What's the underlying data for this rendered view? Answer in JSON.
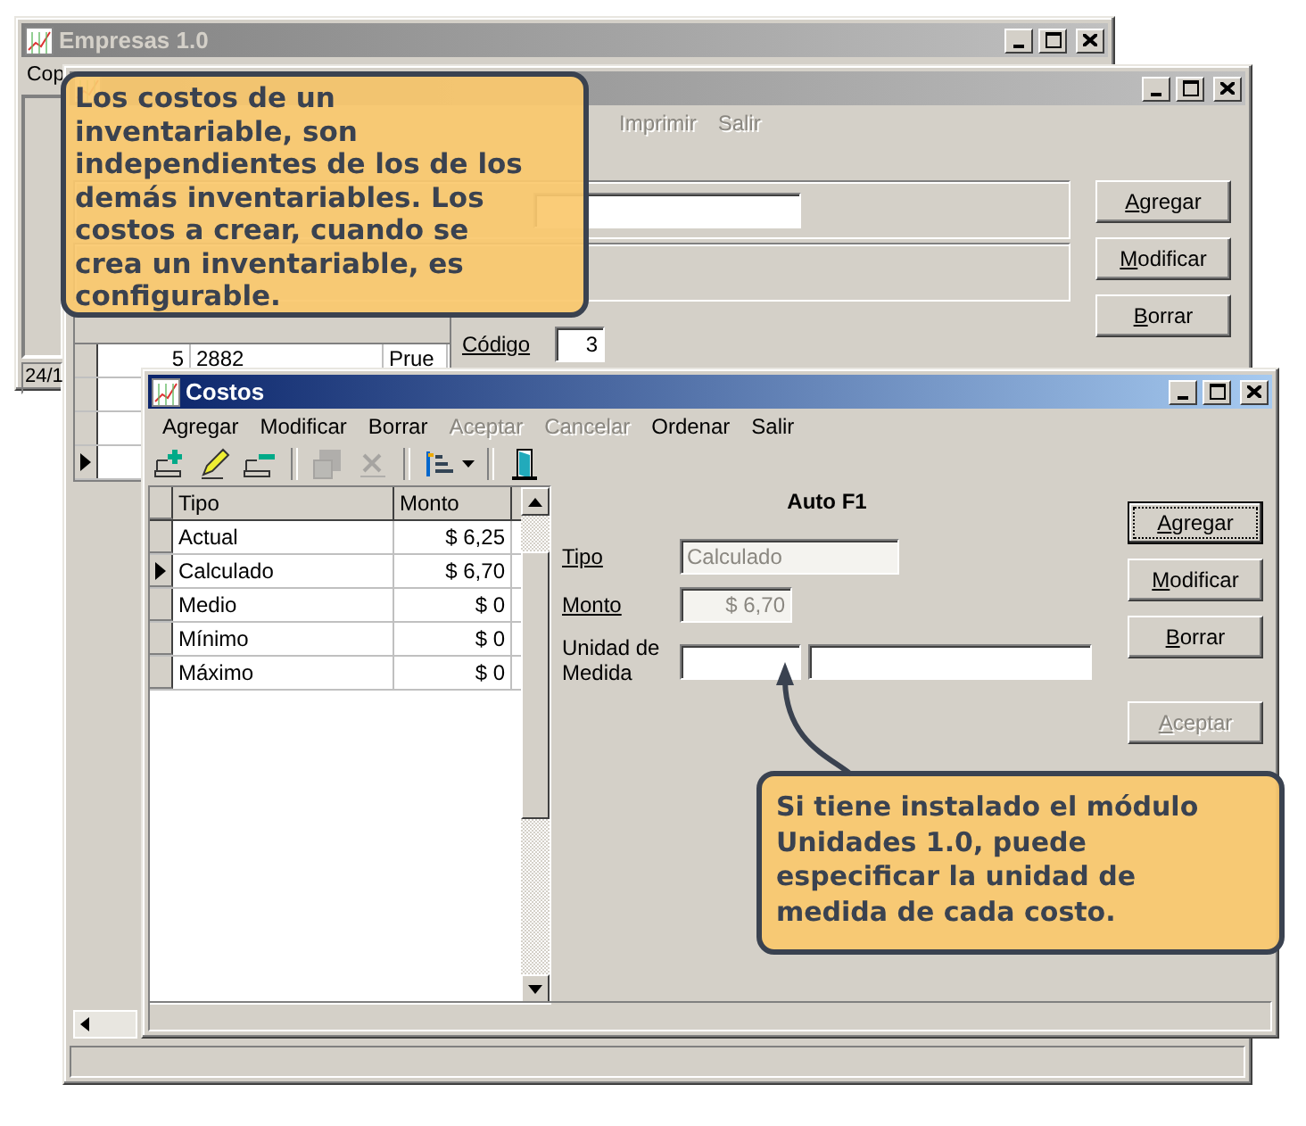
{
  "empresas_window": {
    "title": "Empresas 1.0",
    "active": false,
    "menu": [
      "Cop"
    ],
    "status": "24/1"
  },
  "inventario_window": {
    "active": false,
    "menu": [
      {
        "label": "Imprimir",
        "disabled": true
      },
      {
        "label": "Salir",
        "disabled": true
      }
    ],
    "buttons": [
      "Agregar",
      "Modificar",
      "Borrar"
    ],
    "codigo": {
      "label": "Código",
      "value": "3"
    },
    "rows": [
      {
        "cells": [
          "5",
          "2882",
          "Prue"
        ],
        "selected": false
      },
      {
        "selected": false
      },
      {
        "selected": false
      },
      {
        "selected": true
      }
    ]
  },
  "costos_window": {
    "title": "Costos",
    "active": true,
    "menu": [
      {
        "label": "Agregar",
        "disabled": false
      },
      {
        "label": "Modificar",
        "disabled": false
      },
      {
        "label": "Borrar",
        "disabled": false
      },
      {
        "label": "Aceptar",
        "disabled": true
      },
      {
        "label": "Cancelar",
        "disabled": true
      },
      {
        "label": "Ordenar",
        "disabled": false
      },
      {
        "label": "Salir",
        "disabled": false
      }
    ],
    "toolbar": [
      {
        "kind": "add",
        "disabled": false
      },
      {
        "kind": "edit",
        "disabled": false
      },
      {
        "kind": "remove",
        "disabled": false
      },
      {
        "kind": "sep"
      },
      {
        "kind": "save",
        "disabled": true
      },
      {
        "kind": "cancel",
        "disabled": true
      },
      {
        "kind": "sep"
      },
      {
        "kind": "sort",
        "disabled": false
      },
      {
        "kind": "sep"
      },
      {
        "kind": "exit",
        "disabled": false
      }
    ],
    "grid": {
      "columns": [
        "Tipo",
        "Monto"
      ],
      "rows": [
        {
          "tipo": "Actual",
          "monto": "$ 6,25",
          "selected": false
        },
        {
          "tipo": "Calculado",
          "monto": "$ 6,70",
          "selected": true
        },
        {
          "tipo": "Medio",
          "monto": "$ 0",
          "selected": false
        },
        {
          "tipo": "Mínimo",
          "monto": "$ 0",
          "selected": false
        },
        {
          "tipo": "Máximo",
          "monto": "$ 0",
          "selected": false
        }
      ]
    },
    "heading": "Auto F1",
    "fields": [
      {
        "kind": "text",
        "label": "Tipo",
        "value": "Calculado",
        "disabled": true
      },
      {
        "kind": "amount",
        "label": "Monto",
        "value": "$ 6,70",
        "disabled": true
      },
      {
        "kind": "unit",
        "label": "Unidad de Medida",
        "disabled": false
      }
    ],
    "buttons": [
      {
        "label": "Agregar",
        "disabled": false,
        "focused": true
      },
      {
        "label": "Modificar",
        "disabled": false,
        "focused": false
      },
      {
        "label": "Borrar",
        "disabled": false,
        "focused": false
      },
      {
        "label": "Aceptar",
        "disabled": true,
        "focused": false
      }
    ]
  },
  "callouts": [
    {
      "text": "Los costos de un inventariable, son independientes de los de los demás inventariables. Los costos a crear, cuando se crea un inventariable, es configurable.",
      "arrow": false
    },
    {
      "text": "Si tiene instalado el módulo Unidades 1.0, puede especificar la unidad de medida de cada costo.",
      "arrow": true
    }
  ]
}
